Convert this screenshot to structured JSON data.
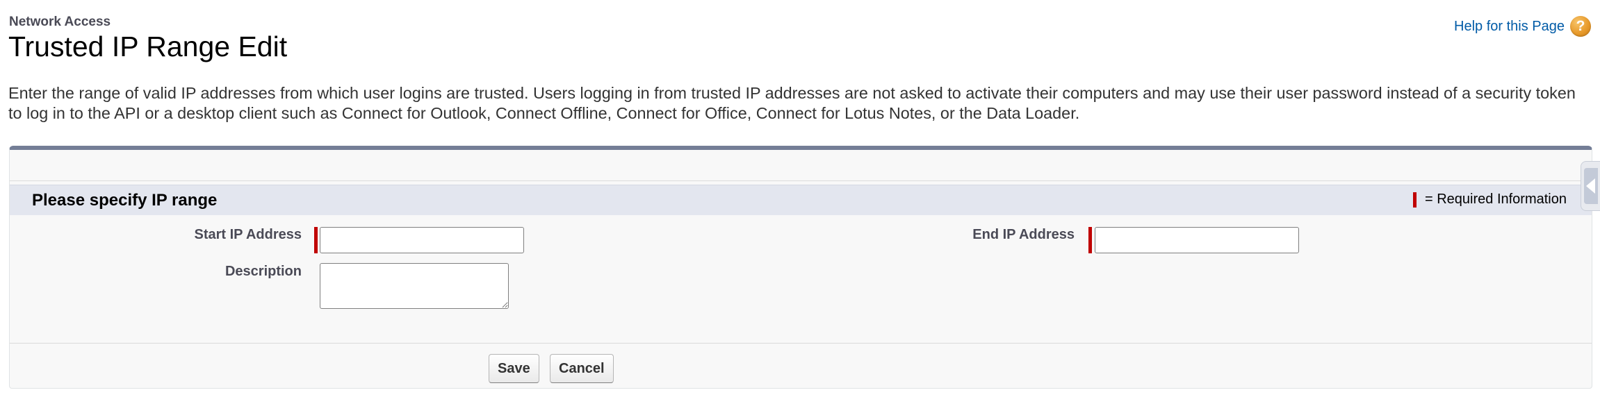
{
  "header": {
    "breadcrumb": "Network Access",
    "title": "Trusted IP Range Edit",
    "help_link": "Help for this Page",
    "help_icon": "question-mark-icon",
    "help_icon_glyph": "?"
  },
  "intro": {
    "text": "Enter the range of valid IP addresses from which user logins are trusted. Users logging in from trusted IP addresses are not asked to activate their computers and may use their user password instead of a security token to log in to the API or a desktop client such as Connect for Outlook, Connect Offline, Connect for Office, Connect for Lotus Notes, or the Data Loader."
  },
  "section": {
    "title": "Please specify IP range",
    "required_legend": "= Required Information"
  },
  "fields": {
    "start_ip": {
      "label": "Start IP Address",
      "value": "",
      "required": true
    },
    "end_ip": {
      "label": "End IP Address",
      "value": "",
      "required": true
    },
    "description": {
      "label": "Description",
      "value": "",
      "required": false
    }
  },
  "buttons": {
    "save": "Save",
    "cancel": "Cancel"
  },
  "colors": {
    "required": "#c00000",
    "link": "#015ba7",
    "panel_border": "#747e96",
    "section_header_bg": "#e3e6ef",
    "help_icon": "#e89b2c"
  }
}
